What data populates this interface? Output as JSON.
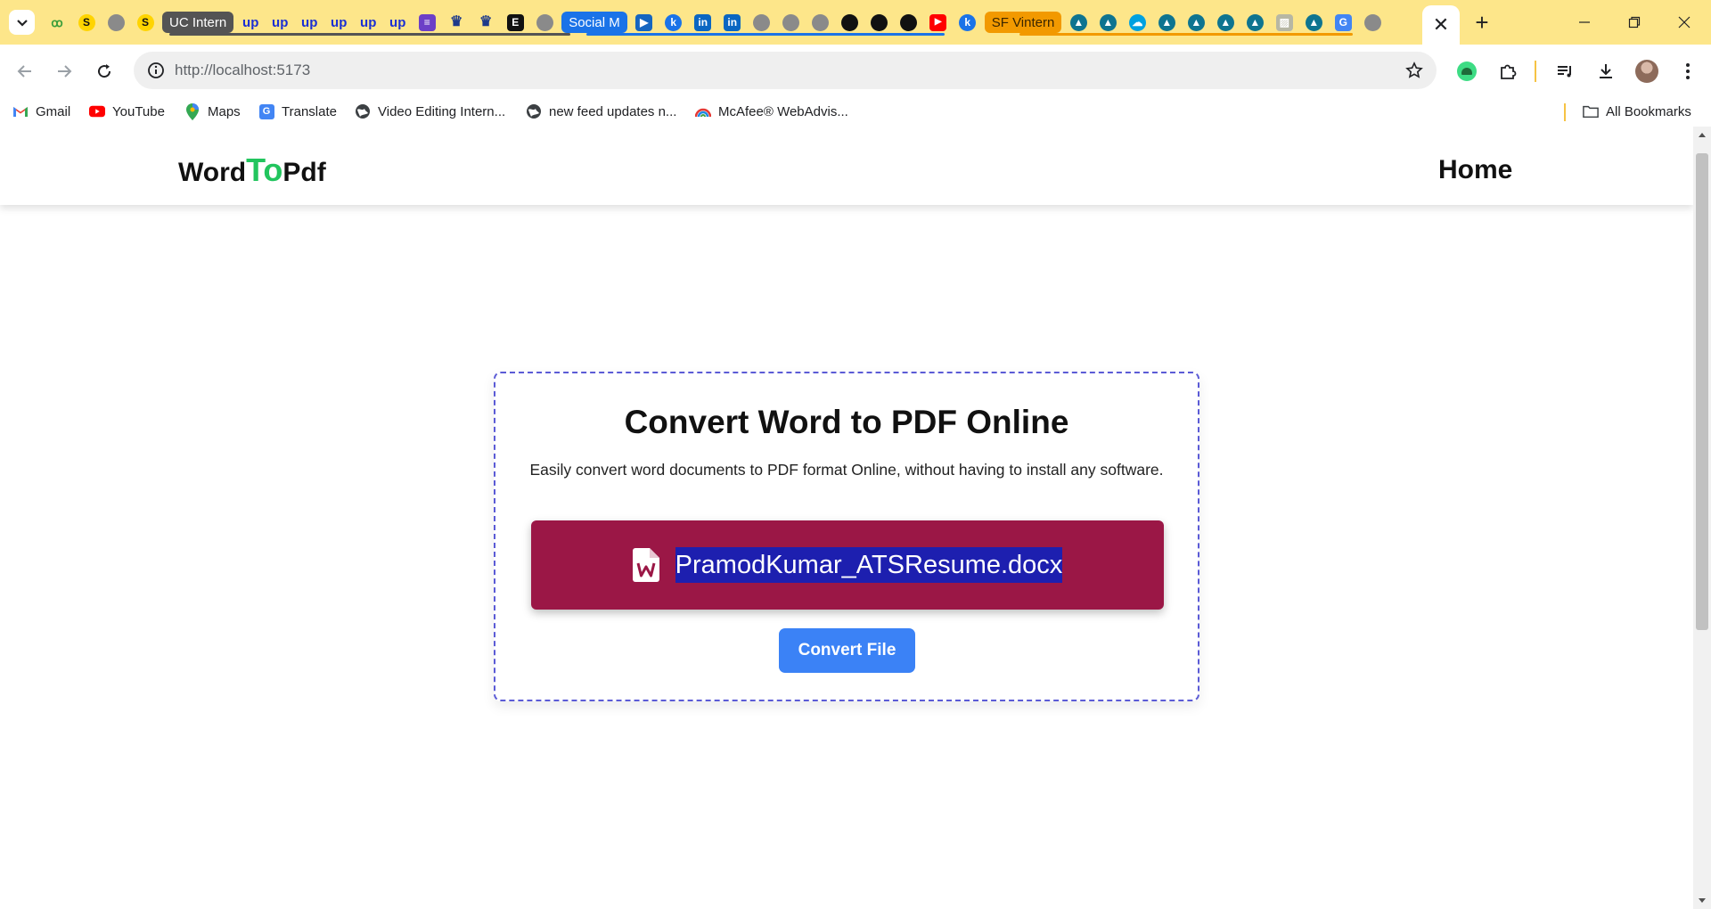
{
  "browser": {
    "tab_groups": [
      {
        "label": "UC Intern",
        "color": "#545454"
      },
      {
        "label": "Social M",
        "color": "#1a73e8"
      },
      {
        "label": "SF Vintern",
        "color": "#f29900"
      }
    ],
    "active_tab": {
      "close_symbol": "✕"
    },
    "new_tab_symbol": "+",
    "url": "http://localhost:5173"
  },
  "bookmarks": {
    "items": [
      {
        "label": "Gmail",
        "icon": "gmail-icon"
      },
      {
        "label": "YouTube",
        "icon": "youtube-icon"
      },
      {
        "label": "Maps",
        "icon": "maps-icon"
      },
      {
        "label": "Translate",
        "icon": "translate-icon"
      },
      {
        "label": "Video Editing Intern...",
        "icon": "globe-icon"
      },
      {
        "label": "new feed updates n...",
        "icon": "globe-icon"
      },
      {
        "label": "McAfee® WebAdvis...",
        "icon": "mcafee-icon"
      }
    ],
    "all_bookmarks": "All Bookmarks"
  },
  "site": {
    "logo": {
      "part1": "Word",
      "part2": "To",
      "part3": "Pdf"
    },
    "nav_home": "Home",
    "accent_color": "#22c55e"
  },
  "converter": {
    "title": "Convert Word to PDF Online",
    "description": "Easily convert word documents to PDF format Online, without having to install any software.",
    "file_name": "PramodKumar_ATSResume.docx",
    "convert_button": "Convert File",
    "drop_color": "#9b1746",
    "button_color": "#3b82f6"
  }
}
